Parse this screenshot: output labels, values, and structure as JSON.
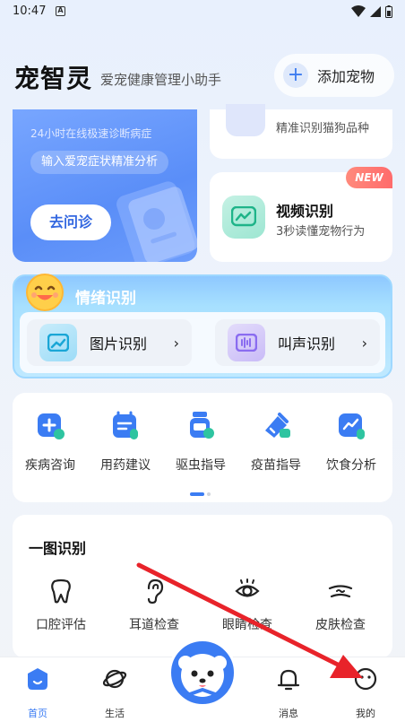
{
  "status_bar": {
    "time": "10:47",
    "notif_letter": "A"
  },
  "header": {
    "title": "宠智灵",
    "subtitle": "爱宠健康管理小助手",
    "add_pet_label": "添加宠物",
    "add_pet_plus": "+"
  },
  "consult_card": {
    "description": "24小时在线极速诊断病症",
    "pill_text": "输入爱宠症状精准分析",
    "button_label": "去问诊"
  },
  "breed_card": {
    "description": "精准识别猫狗品种"
  },
  "video_card": {
    "title": "视频识别",
    "description": "3秒读懂宠物行为",
    "badge": "NEW"
  },
  "emotion": {
    "title": "情绪识别",
    "items": [
      {
        "label": "图片识别",
        "chevron": "›"
      },
      {
        "label": "叫声识别",
        "chevron": "›"
      }
    ]
  },
  "tools": [
    {
      "label": "疾病咨询",
      "icon": "medical-kit-icon"
    },
    {
      "label": "用药建议",
      "icon": "calendar-medicine-icon"
    },
    {
      "label": "驱虫指导",
      "icon": "pill-bottle-icon"
    },
    {
      "label": "疫苗指导",
      "icon": "vaccine-icon"
    },
    {
      "label": "饮食分析",
      "icon": "diet-chart-icon"
    }
  ],
  "scan": {
    "title": "一图识别",
    "items": [
      {
        "label": "口腔评估",
        "icon": "tooth-icon"
      },
      {
        "label": "耳道检查",
        "icon": "ear-icon"
      },
      {
        "label": "眼睛检查",
        "icon": "eye-icon"
      },
      {
        "label": "皮肤检查",
        "icon": "skin-icon"
      }
    ]
  },
  "bottom_nav": {
    "items": [
      {
        "label": "首页",
        "icon": "home-icon",
        "active": true
      },
      {
        "label": "生活",
        "icon": "planet-icon",
        "active": false
      },
      {
        "label": "消息",
        "icon": "bell-icon",
        "active": false
      },
      {
        "label": "我的",
        "icon": "smiley-icon",
        "active": false
      }
    ]
  },
  "colors": {
    "accent": "#3b7cf3",
    "consult_card": "#5a8ef8",
    "new_badge": "#ff6b6b",
    "annotation_arrow": "#e8232a"
  }
}
